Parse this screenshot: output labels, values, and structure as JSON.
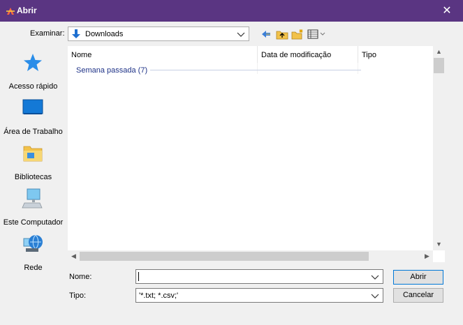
{
  "window": {
    "title": "Abrir",
    "close_glyph": "✕"
  },
  "lookin": {
    "label": "Examinar:",
    "value": "Downloads"
  },
  "toolbar": {
    "icons": [
      "back-icon",
      "up-folder-icon",
      "new-folder-icon",
      "view-menu-icon"
    ]
  },
  "places": [
    {
      "label": "Acesso rápido",
      "icon": "star-icon"
    },
    {
      "label": "Área de Trabalho",
      "icon": "desktop-icon"
    },
    {
      "label": "Bibliotecas",
      "icon": "libraries-folder-icon"
    },
    {
      "label": "Este Computador",
      "icon": "computer-icon"
    },
    {
      "label": "Rede",
      "icon": "network-globe-icon"
    }
  ],
  "filelist": {
    "columns": [
      "Nome",
      "Data de modificação",
      "Tipo"
    ],
    "group_label": "Semana passada (7)"
  },
  "form": {
    "name_label": "Nome:",
    "name_value": "",
    "type_label": "Tipo:",
    "type_value": "'*.txt; *.csv;'"
  },
  "buttons": {
    "open": "Abrir",
    "cancel": "Cancelar"
  },
  "colors": {
    "titlebar": "#5a3582",
    "group_text": "#1e3287"
  }
}
